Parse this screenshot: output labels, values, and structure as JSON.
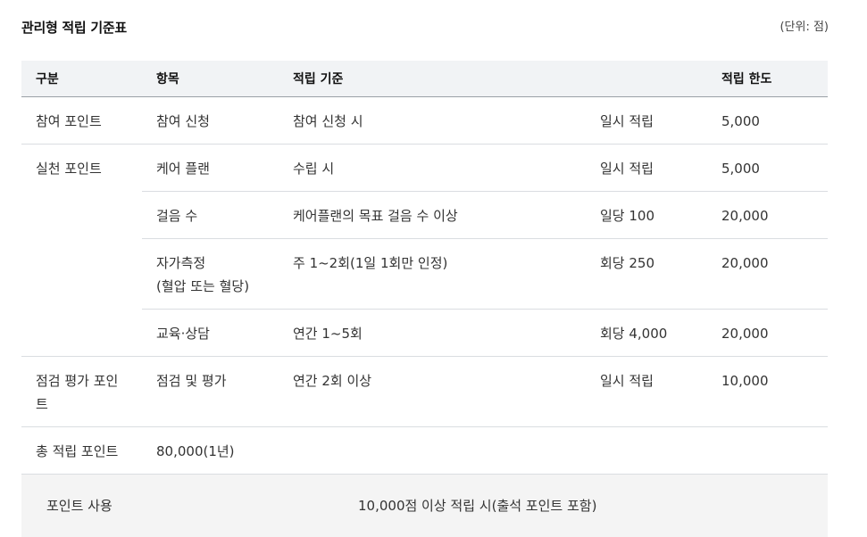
{
  "header": {
    "title": "관리형 적립 기준표",
    "unit": "(단위: 점)"
  },
  "table": {
    "columns": [
      "구분",
      "항목",
      "적립 기준",
      "",
      "적립 한도"
    ],
    "rows": [
      {
        "category": "참여 포인트",
        "item": "참여 신청",
        "criteria": "참여 신청 시",
        "rate": "일시 적립",
        "limit": "5,000"
      },
      {
        "category": "실천 포인트",
        "item": "케어 플랜",
        "criteria": "수립 시",
        "rate": "일시 적립",
        "limit": "5,000"
      },
      {
        "item": "걸음 수",
        "criteria": "케어플랜의 목표 걸음 수 이상",
        "rate": "일당 100",
        "limit": "20,000"
      },
      {
        "item_line1": "자가측정",
        "item_line2": "(혈압 또는 혈당)",
        "criteria": "주 1~2회(1일 1회만 인정)",
        "rate": "회당 250",
        "limit": "20,000"
      },
      {
        "item": "교육·상담",
        "criteria": "연간 1~5회",
        "rate": "회당 4,000",
        "limit": "20,000"
      },
      {
        "category_line1": "점검 평가 포인",
        "category_line2": "트",
        "item": "점검 및 평가",
        "criteria": "연간 2회 이상",
        "rate": "일시 적립",
        "limit": "10,000"
      }
    ],
    "total": {
      "label": "총 적립 포인트",
      "value": "80,000(1년)"
    },
    "usage": {
      "label": "포인트 사용",
      "text": "10,000점 이상 적립 시(출석 포인트 포함)"
    }
  },
  "colors": {
    "header_bg": "#f1f3f5",
    "usage_bg": "#f4f4f4",
    "border": "#dadde1"
  }
}
